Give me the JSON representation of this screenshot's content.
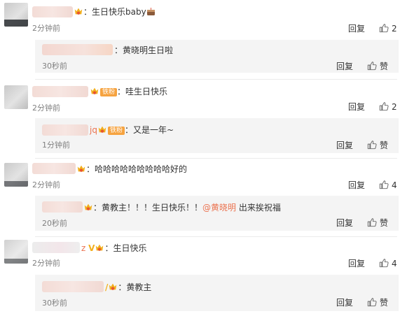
{
  "common": {
    "reply_label": "回复",
    "like_label": "赞"
  },
  "comments": [
    {
      "text": "：生日快乐baby",
      "time": "2分钟前",
      "likes": "2",
      "reply": {
        "username": "",
        "text": "：黄晓明生日啦",
        "time": "30秒前"
      }
    },
    {
      "badge": "铁粉",
      "text": "：哇生日快乐",
      "time": "2分钟前",
      "likes": "2",
      "reply": {
        "username": "jq",
        "badge": "铁粉",
        "text": "：又是一年~",
        "time": "1分钟前"
      }
    },
    {
      "text": "：哈哈哈哈哈哈哈哈哈好的",
      "time": "2分钟前",
      "likes": "4",
      "reply": {
        "text_a": "：黄教主！！！生日快乐！！",
        "mention": "@黄晓明",
        "text_b": " 出来挨祝福",
        "time": "20秒前"
      }
    },
    {
      "username_tail": "z",
      "text": "：生日快乐",
      "time": "2分钟前",
      "likes": "4",
      "reply": {
        "text": "：黄教主",
        "time": "30秒前"
      }
    }
  ],
  "icons": {
    "thumb": "thumbs-up-icon",
    "vip": "vip-crown-icon",
    "cake": "cake-emoji-icon"
  },
  "colors": {
    "mention": "#eb7350",
    "fan_badge": "#f6a340",
    "vip": "#f2b01e"
  }
}
